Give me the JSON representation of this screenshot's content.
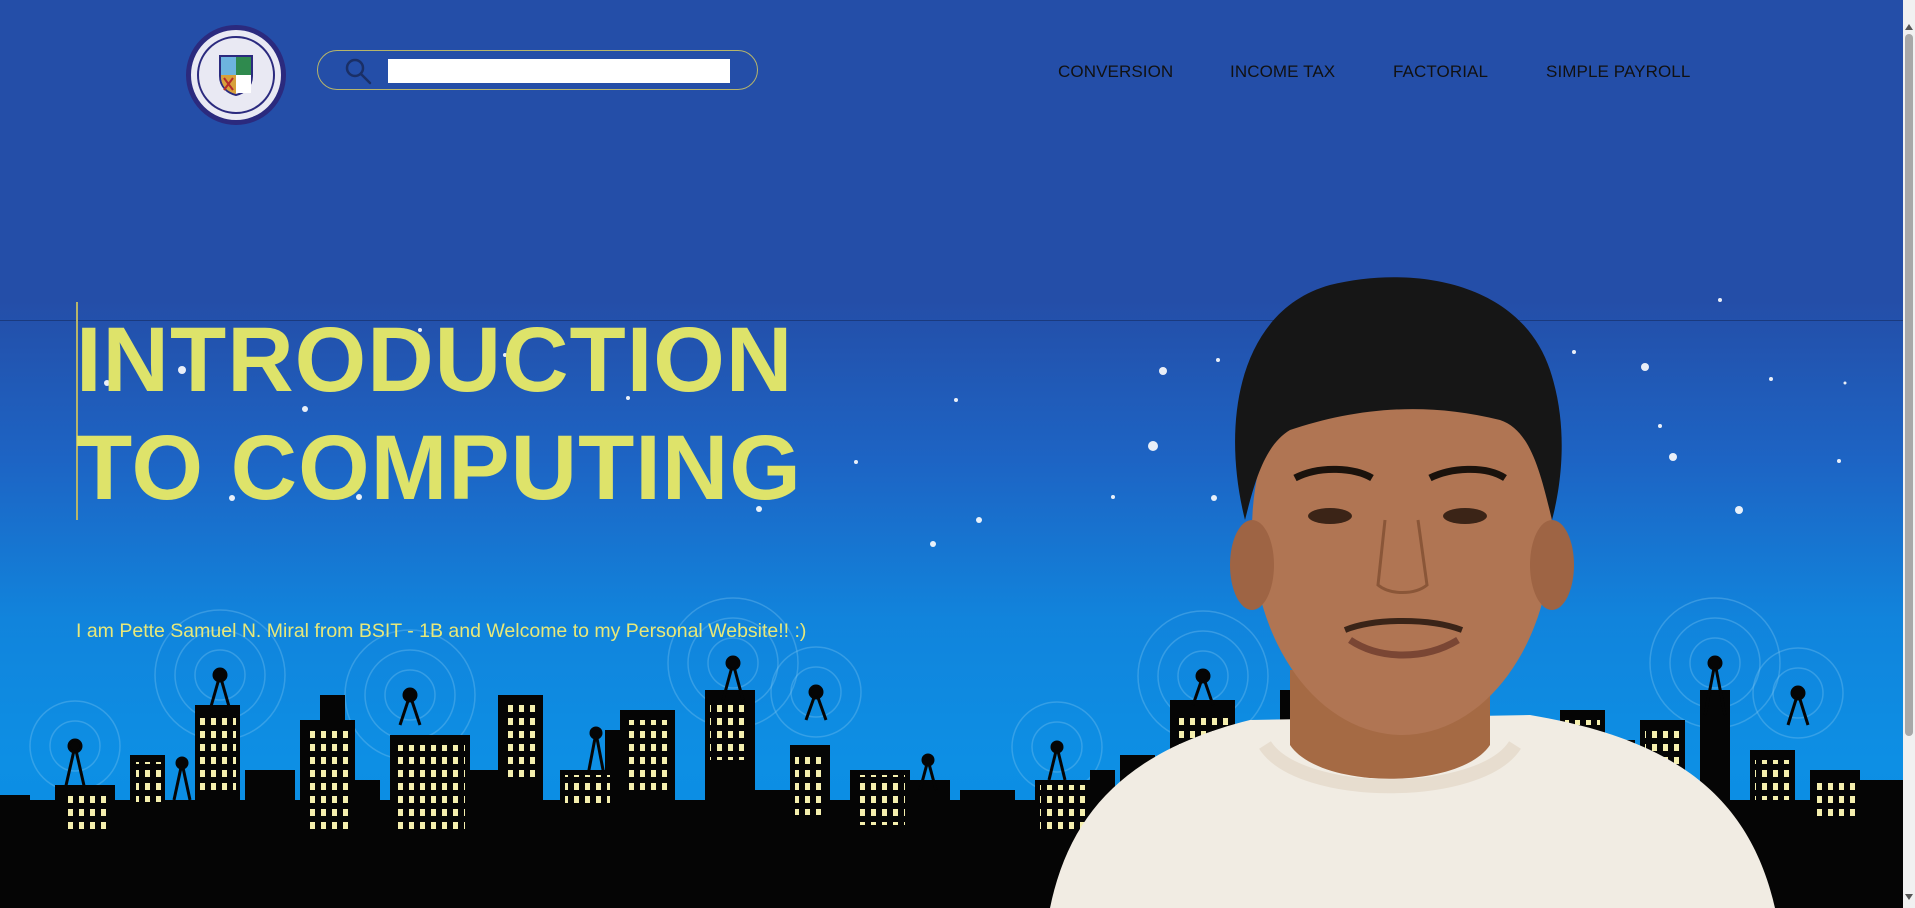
{
  "header": {
    "logo_alt": "FORTES IN FIDE · ATENEO DE DAVAO",
    "search": {
      "placeholder": "",
      "value": ""
    },
    "nav": [
      {
        "label": "CONVERSION"
      },
      {
        "label": "INCOME TAX"
      },
      {
        "label": "FACTORIAL"
      },
      {
        "label": "SIMPLE PAYROLL"
      }
    ]
  },
  "hero": {
    "title": "INTRODUCTION\nTO COMPUTING",
    "tagline": "I am Pette Samuel N. Miral from BSIT - 1B and Welcome to my Personal Website!! :)"
  },
  "colors": {
    "background": "#234fa9",
    "title": "#dee36a",
    "tagline": "#e7e87a",
    "city": "#050505",
    "windows": "#f5efae"
  },
  "icons": [
    "search-icon",
    "school-seal-logo",
    "portrait-photo"
  ]
}
